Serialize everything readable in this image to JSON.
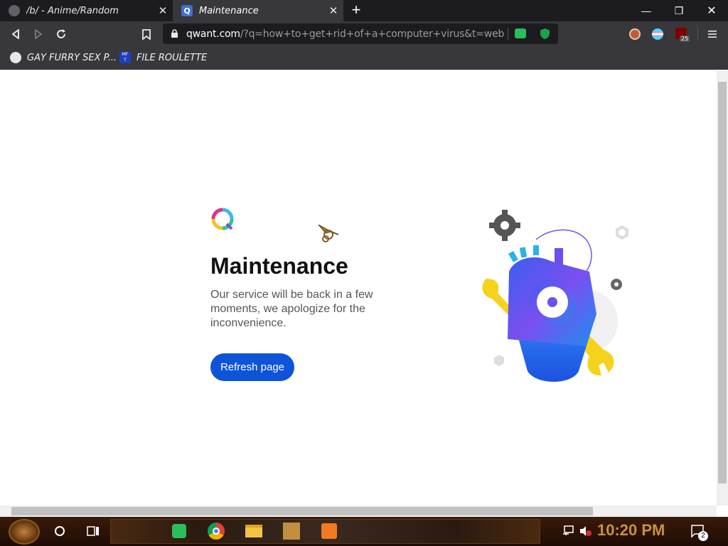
{
  "tabs": [
    {
      "title": "/b/ - Anime/Random",
      "active": false,
      "close_label": "✕"
    },
    {
      "title": "Maintenance",
      "active": true,
      "close_label": "✕"
    }
  ],
  "new_tab_label": "+",
  "window_controls": {
    "minimize": "—",
    "restore": "❐",
    "close": "✕"
  },
  "url": {
    "host": "qwant.com",
    "path": "/?q=how+to+get+rid+of+a+computer+virus&t=web"
  },
  "extension_badge": "25",
  "bookmarks": [
    {
      "label": "GAY FURRY SEX P...",
      "icon": "globe-icon"
    },
    {
      "label": "FILE ROULETTE",
      "icon": "file-roulette-icon"
    }
  ],
  "page": {
    "heading": "Maintenance",
    "description": "Our service will be back in a few moments, we apologize for the inconvenience.",
    "refresh_button": "Refresh page"
  },
  "taskbar": {
    "clock": "10:20 PM",
    "notifications_count": "2"
  },
  "colors": {
    "accent": "#0e54d8",
    "browser_dark": "#1c1b1f",
    "browser_toolbar": "#38373c",
    "clock": "#c8923b"
  }
}
